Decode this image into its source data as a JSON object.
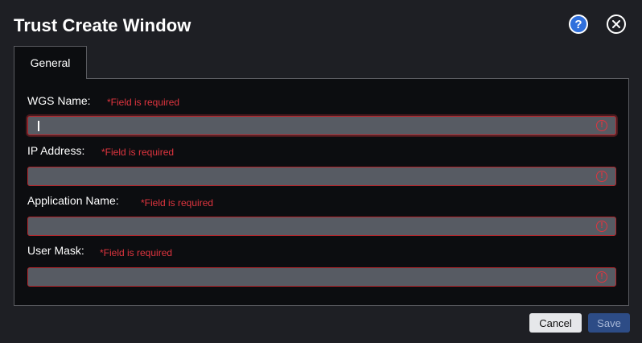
{
  "window": {
    "title": "Trust Create Window",
    "help_glyph": "?"
  },
  "tabs": [
    {
      "label": "General",
      "active": true
    }
  ],
  "form": {
    "fields": [
      {
        "label": "WGS Name:",
        "required_msg": "*Field is required",
        "value": "",
        "focused": true
      },
      {
        "label": "IP Address:",
        "required_msg": "*Field is required",
        "value": "",
        "focused": false
      },
      {
        "label": "Application Name:",
        "required_msg": "*Field is required",
        "value": "",
        "focused": false
      },
      {
        "label": "User Mask:",
        "required_msg": "*Field is required",
        "value": "",
        "focused": false
      }
    ],
    "error_glyph": "!"
  },
  "footer": {
    "cancel_label": "Cancel",
    "save_label": "Save"
  },
  "colors": {
    "background": "#1e1f24",
    "panel": "#0c0d10",
    "input": "#575b63",
    "error": "#e0353f",
    "help_accent": "#2f6fdc",
    "save_button": "#2d4c86"
  },
  "icons": {
    "help": "help-icon",
    "close": "close-icon",
    "field_error": "error-icon"
  }
}
